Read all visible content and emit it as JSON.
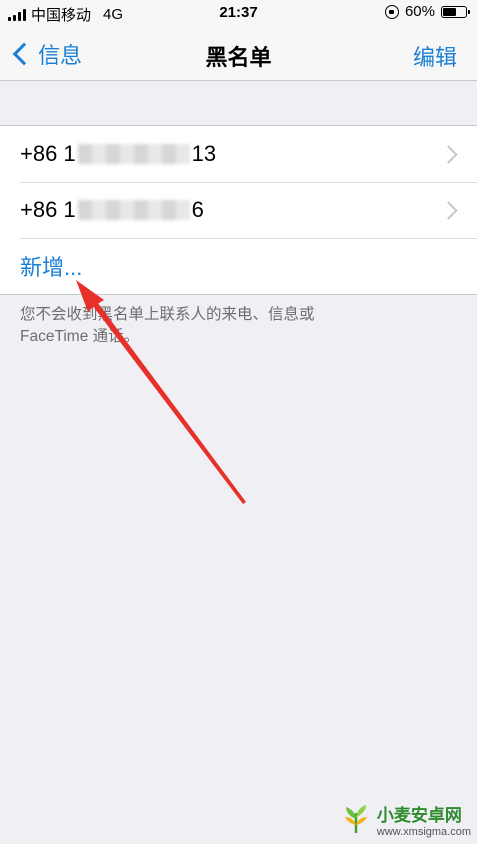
{
  "status_bar": {
    "carrier": "中国移动",
    "network": "4G",
    "time": "21:37",
    "battery_percent": "60%",
    "battery_level": 0.6
  },
  "nav": {
    "back_label": "信息",
    "title": "黑名单",
    "edit_label": "编辑"
  },
  "blocked_list": [
    {
      "prefix": "+86 1",
      "suffix": "13"
    },
    {
      "prefix": "+86 1",
      "suffix": "6"
    }
  ],
  "add_new_label": "新增...",
  "footer_note": "您不会收到黑名单上联系人的来电、信息或FaceTime 通话。",
  "watermark": {
    "title": "小麦安卓网",
    "url": "www.xmsigma.com"
  },
  "colors": {
    "accent": "#1a7fd4",
    "arrow": "#e8302a",
    "background": "#efeff4"
  }
}
